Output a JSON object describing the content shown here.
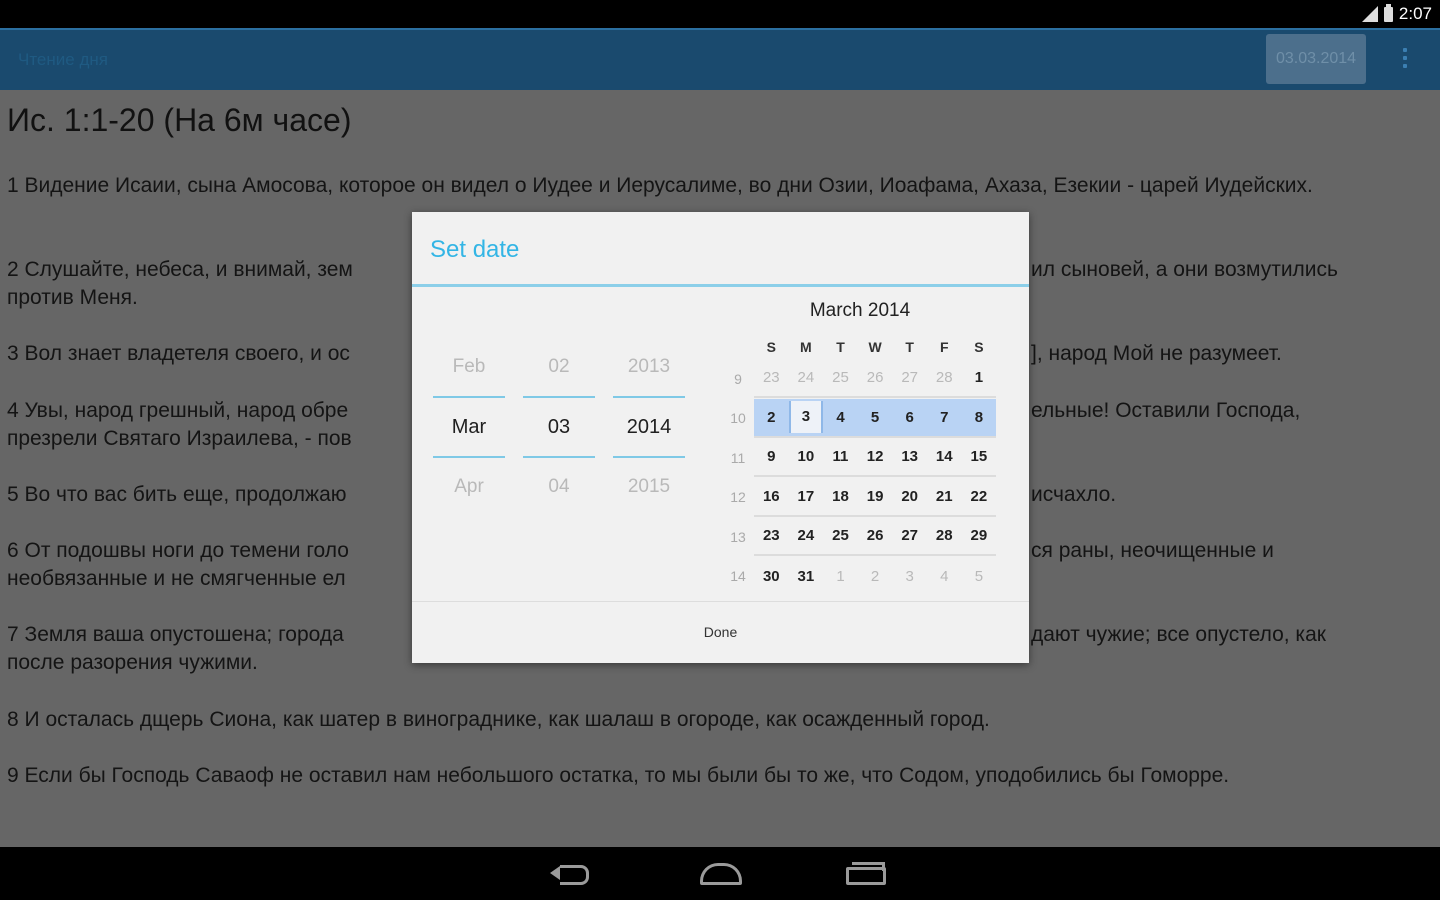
{
  "status": {
    "time": "2:07",
    "icons": [
      "signal-icon",
      "battery-icon"
    ]
  },
  "actionbar": {
    "title": "Чтение дня",
    "date_button": "03.03.2014",
    "menu_icon": "overflow-menu-icon"
  },
  "reading": {
    "title": "Ис. 1:1-20 (На 6м часе)",
    "verses": [
      "1 Видение Исаии, сына Амосова, которое он видел о Иудее и Иерусалиме, во дни Озии, Иоафама, Ахаза, Езекии - царей Иудейских.",
      "2 Слушайте, небеса, и внимай, зем",
      "ил сыновей, а они возмутились",
      "против Меня.",
      "3 Вол знает владетеля своего, и ос",
      "], народ Мой не разумеет.",
      "4 Увы, народ грешный, народ обре",
      "ельные! Оставили Господа,",
      "презрели Святаго Израилева, - пов",
      "5 Во что вас бить еще, продолжаю",
      "исчахло.",
      "6 От подошвы ноги до темени голо",
      "ся раны, неочищенные и",
      "необвязанные и не смягченные ел",
      "7 Земля ваша опустошена; города",
      "дают чужие; все опустело, как",
      "после разорения чужими.",
      "8 И осталась дщерь Сиона, как шатер в винограднике, как шалаш в огороде, как осажденный город.",
      "9 Если бы Господь Саваоф не оставил нам небольшого остатка, то мы были бы то же, что Содом, уподобились бы Гоморре."
    ]
  },
  "dialog": {
    "title": "Set date",
    "pickers": {
      "month": {
        "prev": "Feb",
        "current": "Mar",
        "next": "Apr"
      },
      "day": {
        "prev": "02",
        "current": "03",
        "next": "04"
      },
      "year": {
        "prev": "2013",
        "current": "2014",
        "next": "2015"
      }
    },
    "calendar": {
      "title": "March 2014",
      "weekday_headers": [
        "S",
        "M",
        "T",
        "W",
        "T",
        "F",
        "S"
      ],
      "weeks": [
        {
          "week": "9",
          "days": [
            "23",
            "24",
            "25",
            "26",
            "27",
            "28",
            "1"
          ]
        },
        {
          "week": "10",
          "days": [
            "2",
            "3",
            "4",
            "5",
            "6",
            "7",
            "8"
          ]
        },
        {
          "week": "11",
          "days": [
            "9",
            "10",
            "11",
            "12",
            "13",
            "14",
            "15"
          ]
        },
        {
          "week": "12",
          "days": [
            "16",
            "17",
            "18",
            "19",
            "20",
            "21",
            "22"
          ]
        },
        {
          "week": "13",
          "days": [
            "23",
            "24",
            "25",
            "26",
            "27",
            "28",
            "29"
          ]
        },
        {
          "week": "14",
          "days": [
            "30",
            "31",
            "1",
            "2",
            "3",
            "4",
            "5"
          ]
        }
      ],
      "selected_day": "3"
    },
    "done_label": "Done"
  },
  "colors": {
    "accent": "#33b5e5",
    "selection": "#b9d3f4",
    "actionbar": "#1a4a6e"
  }
}
